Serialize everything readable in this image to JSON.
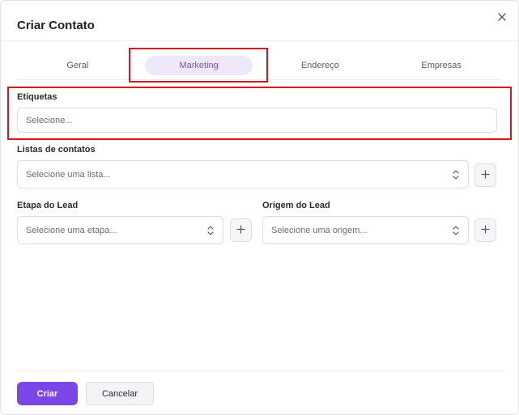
{
  "dialog": {
    "title": "Criar Contato"
  },
  "tabs": [
    {
      "label": "Geral",
      "active": false
    },
    {
      "label": "Marketing",
      "active": true
    },
    {
      "label": "Endereço",
      "active": false
    },
    {
      "label": "Empresas",
      "active": false
    }
  ],
  "fields": {
    "tags": {
      "label": "Etiquetas",
      "placeholder": "Selecione..."
    },
    "contact_lists": {
      "label": "Listas de contatos",
      "placeholder": "Selecione uma lista..."
    },
    "lead_stage": {
      "label": "Etapa do Lead",
      "placeholder": "Selecione uma etapa..."
    },
    "lead_origin": {
      "label": "Origem do Lead",
      "placeholder": "Selecione uma origem..."
    }
  },
  "footer": {
    "create_label": "Criar",
    "cancel_label": "Cancelar"
  },
  "colors": {
    "accent": "#7b46e8",
    "active_tab_bg": "#ede9fb",
    "active_tab_text": "#7a4fd6",
    "annotation": "#d4151e"
  },
  "icons": {
    "close": "close-icon",
    "caret": "chevron-up-down-icon",
    "add": "plus-icon"
  }
}
